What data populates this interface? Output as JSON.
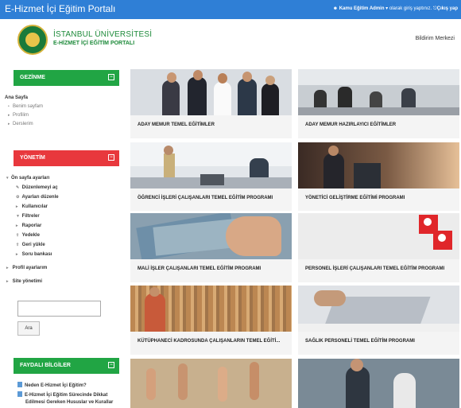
{
  "topbar": {
    "brand": "E-Hizmet İçi Eğitim Portalı",
    "user_name": "Kamu Eğitim Admin",
    "login_text": "olarak giriş yaptınız.",
    "logout_label": "Çıkış yap"
  },
  "header": {
    "org_name": "İSTANBUL ÜNİVERSİTESİ",
    "portal_name": "E-HİZMET İÇİ EĞİTİM PORTALI",
    "notifications_label": "Bildirim Merkezi"
  },
  "sidebar": {
    "nav_block": {
      "title": "GEZİNME",
      "home": "Ana Sayfa",
      "items": [
        "Benim sayfam",
        "Profilim",
        "Derslerim"
      ]
    },
    "admin_block": {
      "title": "YÖNETİM",
      "front_settings": "Ön sayfa ayarları",
      "items": [
        "Düzenlemeyi aç",
        "Ayarları düzenle",
        "Kullanıcılar",
        "Filtreler",
        "Raporlar",
        "Yedekle",
        "Geri yükle",
        "Soru bankası"
      ],
      "profile_settings": "Profil ayarlarım",
      "site_admin": "Site yönetimi"
    },
    "search": {
      "value": "",
      "button": "Ara"
    },
    "info_block": {
      "title": "FAYDALI BİLGİLER",
      "items": [
        "Neden E-Hizmet İçi Eğitim?",
        "E-Hizmet İçi Eğitim Sürecinde Dikkat",
        "Edilmesi Gereken Hususlar ve Kurallar"
      ]
    }
  },
  "courses": [
    {
      "title": "ADAY MEMUR TEMEL EĞİTİMLER",
      "image": "business-team-photo"
    },
    {
      "title": "ADAY MEMUR HAZIRLAYICI EĞİTİMLER",
      "image": "classroom-photo"
    },
    {
      "title": "ÖĞRENCİ İŞLERİ ÇALIŞANLARI TEMEL EĞİTİM PROGRAMI",
      "image": "office-photo"
    },
    {
      "title": "YÖNETİCİ GELİŞTİRME EĞİTİMİ PROGRAMI",
      "image": "speaker-photo"
    },
    {
      "title": "MALİ İŞLER ÇALIŞANLARI TEMEL EĞİTİM PROGRAMI",
      "image": "banknotes-photo"
    },
    {
      "title": "PERSONEL İŞLERİ ÇALIŞANLARI TEMEL EĞİTİM PROGRAMI",
      "image": "personnel-icons-photo"
    },
    {
      "title": "KÜTÜPHANECİ KADROSUNDA ÇALIŞANLARIN TEMEL EĞİTİ...",
      "image": "library-photo"
    },
    {
      "title": "SAĞLIK PERSONELİ TEMEL EĞİTİM PROGRAMI",
      "image": "laptop-photo"
    },
    {
      "title": "",
      "image": "raised-hands-photo"
    },
    {
      "title": "",
      "image": "call-center-photo"
    }
  ],
  "colors": {
    "topbar": "#2f7fd6",
    "nav_block": "#21a544",
    "admin_block": "#e8383d",
    "info_block": "#21a544"
  }
}
